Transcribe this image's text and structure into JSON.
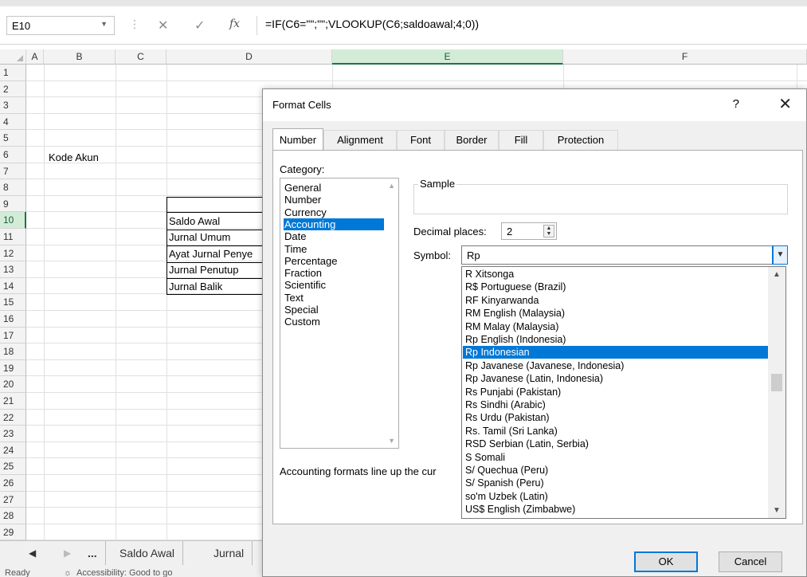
{
  "formula_bar": {
    "name_box": "E10",
    "formula": "=IF(C6=\"\";\"\";VLOOKUP(C6;saldoawal;4;0))",
    "cancel_glyph": "✕",
    "enter_glyph": "✓",
    "fx_label": "fx"
  },
  "grid": {
    "columns": [
      "A",
      "B",
      "C",
      "D",
      "E",
      "F"
    ],
    "selected_column": "E",
    "rows": [
      "1",
      "2",
      "3",
      "4",
      "5",
      "6",
      "7",
      "8",
      "9",
      "10",
      "11",
      "12",
      "13",
      "14",
      "15",
      "16",
      "17",
      "18",
      "19",
      "20",
      "21",
      "22",
      "23",
      "24",
      "25",
      "26",
      "27",
      "28",
      "29"
    ],
    "selected_row": "10",
    "cells": {
      "b6": "Kode Akun",
      "d10": "Saldo Awal",
      "d11": "Jurnal Umum",
      "d12": "Ayat Jurnal Penye",
      "d13": "Jurnal Penutup",
      "d14": "Jurnal Balik"
    }
  },
  "sheet_tabs": {
    "nav_prev": "◀",
    "nav_next": "▶",
    "more": "...",
    "tabs": [
      "Saldo Awal",
      "Jurnal"
    ]
  },
  "status_bar": {
    "ready": "Ready",
    "accessibility": "Accessibility: Good to go"
  },
  "dialog": {
    "title": "Format Cells",
    "help": "?",
    "close": "✕",
    "tabs": [
      "Number",
      "Alignment",
      "Font",
      "Border",
      "Fill",
      "Protection"
    ],
    "active_tab": "Number",
    "category_label": "Category:",
    "categories": [
      "General",
      "Number",
      "Currency",
      "Accounting",
      "Date",
      "Time",
      "Percentage",
      "Fraction",
      "Scientific",
      "Text",
      "Special",
      "Custom"
    ],
    "selected_category": "Accounting",
    "sample_label": "Sample",
    "sample_value": "",
    "decimal_label": "Decimal places:",
    "decimal_value": "2",
    "symbol_label": "Symbol:",
    "symbol_value": "Rp",
    "symbol_options": [
      "R Xitsonga",
      "R$ Portuguese (Brazil)",
      "RF Kinyarwanda",
      "RM English (Malaysia)",
      "RM Malay (Malaysia)",
      "Rp English (Indonesia)",
      "Rp Indonesian",
      "Rp Javanese (Javanese, Indonesia)",
      "Rp Javanese (Latin, Indonesia)",
      "Rs Punjabi (Pakistan)",
      "Rs Sindhi (Arabic)",
      "Rs Urdu (Pakistan)",
      "Rs. Tamil (Sri Lanka)",
      "RSD Serbian (Latin, Serbia)",
      "S Somali",
      "S/ Quechua (Peru)",
      "S/ Spanish (Peru)",
      "so'm Uzbek (Latin)",
      "US$ English (Zimbabwe)"
    ],
    "selected_symbol": "Rp Indonesian",
    "note": "Accounting formats line up the cur",
    "ok": "OK",
    "cancel": "Cancel"
  },
  "colors": {
    "accent": "#0078d7",
    "excel_green": "#217346",
    "header_selected": "#d3ecd8"
  }
}
